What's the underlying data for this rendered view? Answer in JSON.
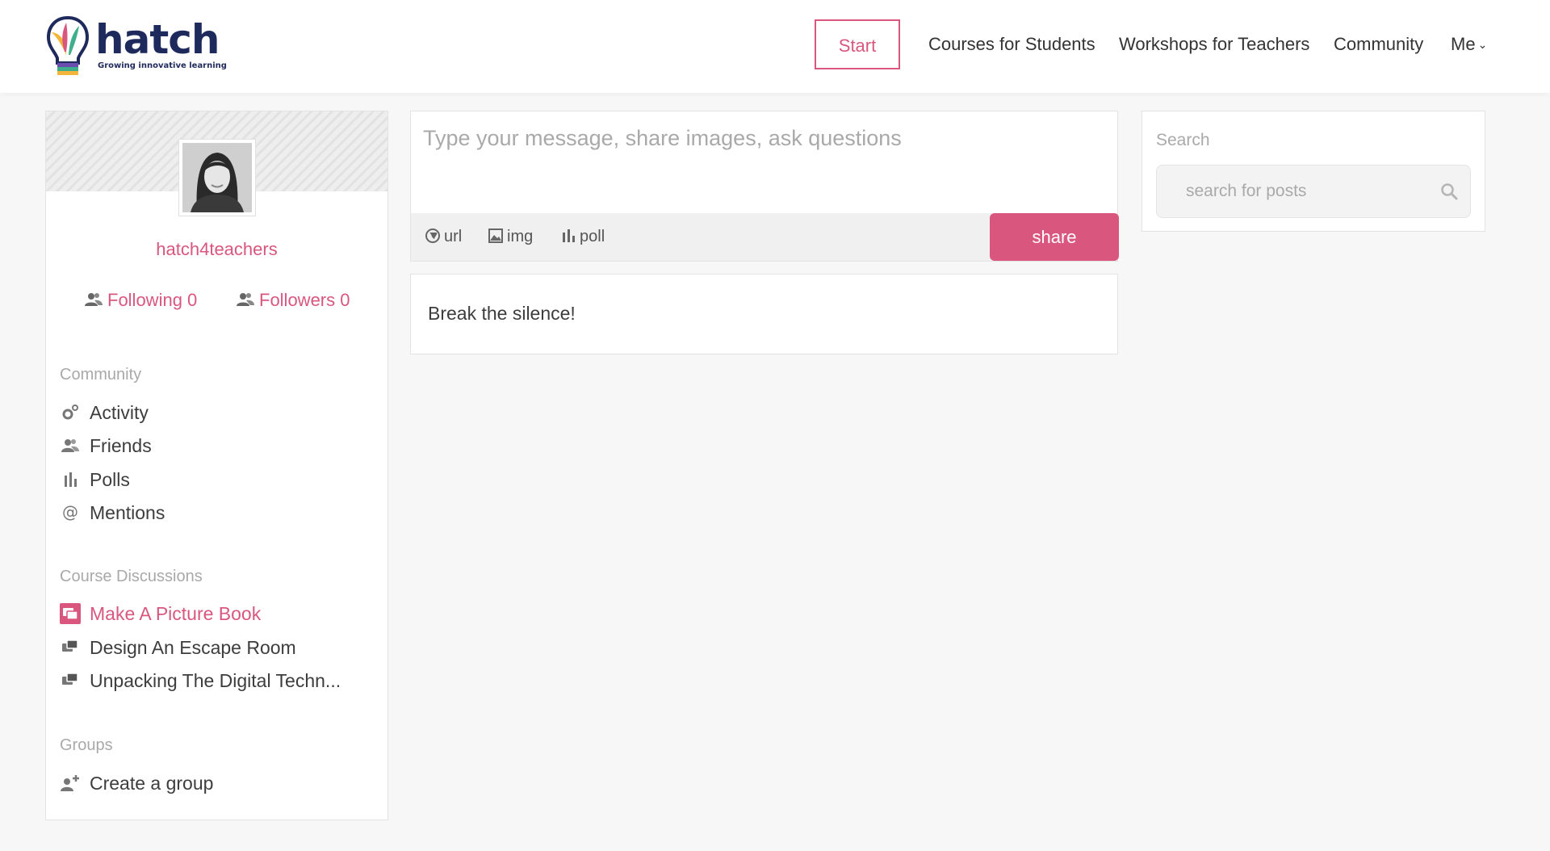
{
  "brand": {
    "name": "hatch",
    "tagline": "Growing innovative learning",
    "accent_color": "#d9577f",
    "navy_color": "#1f2a5c"
  },
  "nav": {
    "start": "Start",
    "courses": "Courses for Students",
    "workshops": "Workshops for Teachers",
    "community": "Community",
    "me": "Me"
  },
  "profile": {
    "username": "hatch4teachers",
    "following": "Following 0",
    "followers": "Followers 0"
  },
  "sidebar": {
    "community_heading": "Community",
    "community_items": [
      {
        "label": "Activity",
        "icon": "gears-icon"
      },
      {
        "label": "Friends",
        "icon": "users-icon"
      },
      {
        "label": "Polls",
        "icon": "bar-chart-icon"
      },
      {
        "label": "Mentions",
        "icon": "at-icon"
      }
    ],
    "courses_heading": "Course Discussions",
    "course_items": [
      {
        "label": "Make A Picture Book",
        "icon": "chat-bubbles-icon",
        "active": true
      },
      {
        "label": "Design An Escape Room",
        "icon": "chat-bubbles-icon"
      },
      {
        "label": "Unpacking The Digital Techn...",
        "icon": "chat-bubbles-icon"
      }
    ],
    "groups_heading": "Groups",
    "group_items": [
      {
        "label": "Create a group",
        "icon": "add-user-icon"
      }
    ]
  },
  "composer": {
    "placeholder": "Type your message, share images, ask questions",
    "url": "url",
    "img": "img",
    "poll": "poll",
    "share": "share"
  },
  "feed": {
    "empty_message": "Break the silence!"
  },
  "search": {
    "label": "Search",
    "placeholder": "search for posts"
  }
}
